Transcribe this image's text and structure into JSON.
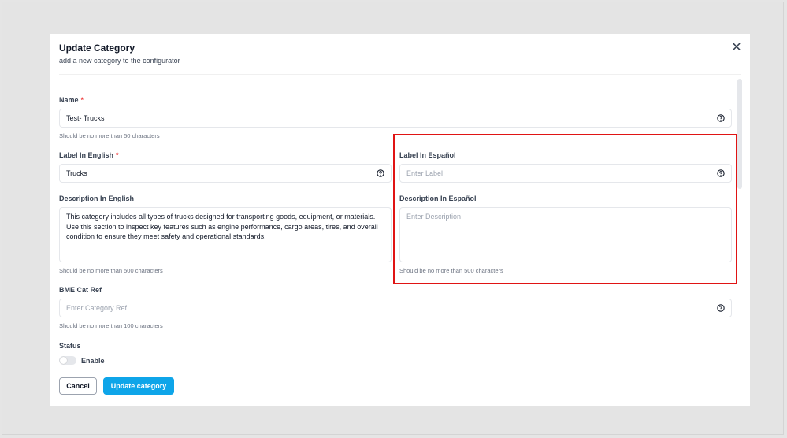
{
  "modal": {
    "title": "Update Category",
    "subtitle": "add a new category to the configurator"
  },
  "fields": {
    "name": {
      "label": "Name",
      "required_mark": "*",
      "value": "Test- Trucks",
      "hint": "Should be no more than 50 characters"
    },
    "label_en": {
      "label": "Label In English",
      "required_mark": "*",
      "value": "Trucks"
    },
    "label_es": {
      "label": "Label In Español",
      "placeholder": "Enter Label"
    },
    "description_en": {
      "label": "Description In English",
      "value": "This category includes all types of trucks designed for transporting goods, equipment, or materials. Use this section to inspect key features such as engine performance, cargo areas, tires, and overall condition to ensure they meet safety and operational standards.",
      "hint": "Should be no more than 500 characters"
    },
    "description_es": {
      "label": "Description In Español",
      "placeholder": "Enter Description",
      "hint": "Should be no more than 500 characters"
    },
    "bme_cat_ref": {
      "label": "BME Cat Ref",
      "placeholder": "Enter Category Ref",
      "hint": "Should be no more than 100 characters"
    },
    "status": {
      "label": "Status",
      "toggle_label": "Enable",
      "enabled": false
    }
  },
  "buttons": {
    "cancel": "Cancel",
    "update": "Update category"
  },
  "icons": {
    "close": "close-icon",
    "help": "help-circle-icon"
  },
  "colors": {
    "accent": "#0ea5e9",
    "required": "#ef4444",
    "highlight": "#e01414"
  }
}
